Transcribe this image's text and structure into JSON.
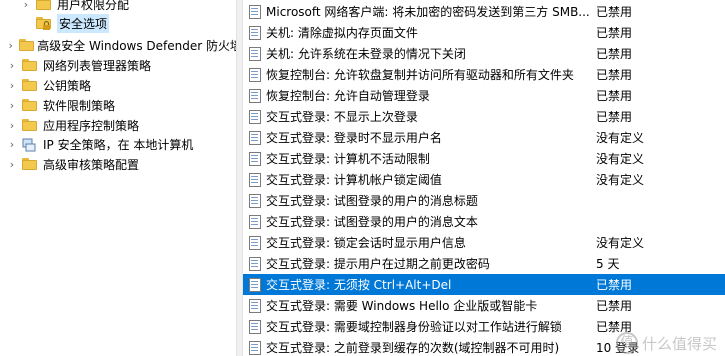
{
  "tree": {
    "items": [
      {
        "label": "用户权限分配",
        "expanded": false,
        "indent": 1,
        "selected": false,
        "icon": "folder-icon"
      },
      {
        "label": "安全选项",
        "expanded": false,
        "indent": 1,
        "selected": true,
        "icon": "folder-lock-icon"
      },
      {
        "label": "高级安全 Windows Defender 防火墙",
        "expanded": false,
        "indent": 0,
        "selected": false,
        "icon": "folder-icon"
      },
      {
        "label": "网络列表管理器策略",
        "expanded": false,
        "indent": 0,
        "selected": false,
        "icon": "folder-icon"
      },
      {
        "label": "公钥策略",
        "expanded": false,
        "indent": 0,
        "selected": false,
        "icon": "folder-icon"
      },
      {
        "label": "软件限制策略",
        "expanded": false,
        "indent": 0,
        "selected": false,
        "icon": "folder-icon"
      },
      {
        "label": "应用程序控制策略",
        "expanded": false,
        "indent": 0,
        "selected": false,
        "icon": "folder-icon"
      },
      {
        "label": "IP 安全策略，在 本地计算机",
        "expanded": false,
        "indent": 0,
        "selected": false,
        "icon": "ip-security-icon"
      },
      {
        "label": "高级审核策略配置",
        "expanded": false,
        "indent": 0,
        "selected": false,
        "icon": "folder-icon"
      }
    ]
  },
  "policies": [
    {
      "name": "Microsoft 网络客户端: 将未加密的密码发送到第三方 SMB...",
      "setting": "已禁用"
    },
    {
      "name": "关机: 清除虚拟内存页面文件",
      "setting": "已禁用"
    },
    {
      "name": "关机: 允许系统在未登录的情况下关闭",
      "setting": "已禁用"
    },
    {
      "name": "恢复控制台: 允许软盘复制并访问所有驱动器和所有文件夹",
      "setting": "已禁用"
    },
    {
      "name": "恢复控制台: 允许自动管理登录",
      "setting": "已禁用"
    },
    {
      "name": "交互式登录: 不显示上次登录",
      "setting": "已禁用"
    },
    {
      "name": "交互式登录: 登录时不显示用户名",
      "setting": "没有定义"
    },
    {
      "name": "交互式登录: 计算机不活动限制",
      "setting": "没有定义"
    },
    {
      "name": "交互式登录: 计算机帐户锁定阈值",
      "setting": "没有定义"
    },
    {
      "name": "交互式登录: 试图登录的用户的消息标题",
      "setting": ""
    },
    {
      "name": "交互式登录: 试图登录的用户的消息文本",
      "setting": ""
    },
    {
      "name": "交互式登录: 锁定会话时显示用户信息",
      "setting": "没有定义"
    },
    {
      "name": "交互式登录: 提示用户在过期之前更改密码",
      "setting": "5 天"
    },
    {
      "name": "交互式登录: 无须按 Ctrl+Alt+Del",
      "setting": "已禁用",
      "selected": true
    },
    {
      "name": "交互式登录: 需要 Windows Hello 企业版或智能卡",
      "setting": "已禁用"
    },
    {
      "name": "交互式登录: 需要域控制器身份验证以对工作站进行解锁",
      "setting": "已禁用"
    },
    {
      "name": "交互式登录: 之前登录到缓存的次数(域控制器不可用时)",
      "setting": "10 登录"
    }
  ],
  "watermark": {
    "glyph": "值",
    "text": "什么值得买"
  },
  "colors": {
    "selection": "#0078d7",
    "tree_selection": "#cce8ff",
    "folder": "#f2c94c"
  }
}
